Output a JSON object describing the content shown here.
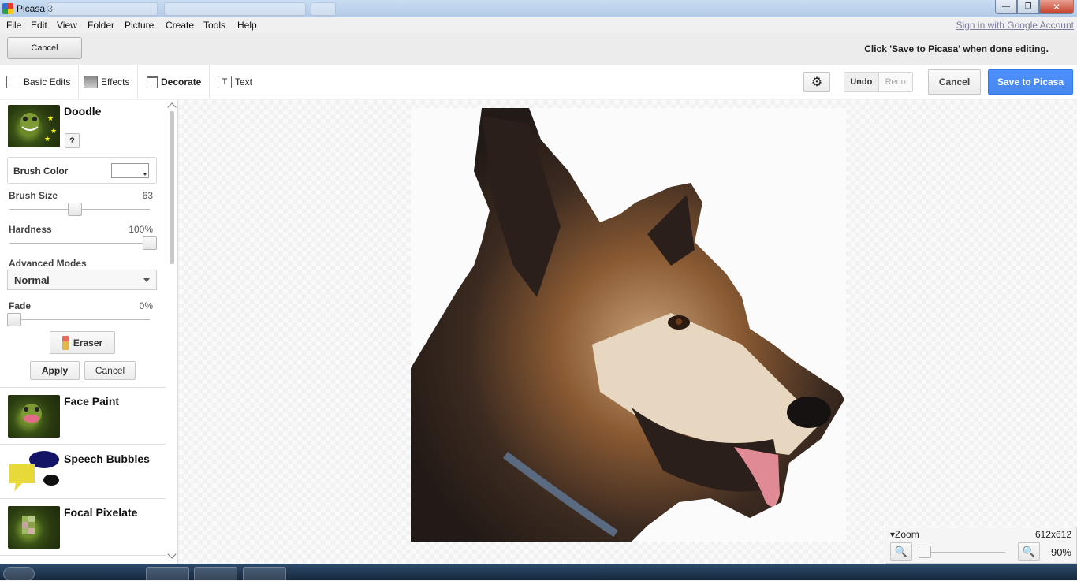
{
  "window": {
    "title": "Picasa 3",
    "minimize_glyph": "—",
    "restore_glyph": "❐",
    "close_glyph": "✕"
  },
  "menu": {
    "items": [
      "File",
      "Edit",
      "View",
      "Folder",
      "Picture",
      "Create",
      "Tools",
      "Help"
    ],
    "sign_in": "Sign in with Google Account"
  },
  "topbar": {
    "cancel_label": "Cancel",
    "hint": "Click 'Save to Picasa' when done editing."
  },
  "toolbar": {
    "tabs": [
      {
        "label": "Basic Edits",
        "icon": "basic-edits-icon"
      },
      {
        "label": "Effects",
        "icon": "effects-icon"
      },
      {
        "label": "Decorate",
        "icon": "paint-roller-icon"
      },
      {
        "label": "Text",
        "icon": "text-icon"
      }
    ],
    "active_tab": "Decorate",
    "settings_glyph": "⚙",
    "undo_label": "Undo",
    "redo_label": "Redo",
    "cancel_label": "Cancel",
    "save_label": "Save to Picasa",
    "save_color": "#4d90fe"
  },
  "doodle": {
    "title": "Doodle",
    "help_label": "?",
    "brush_color_label": "Brush Color",
    "brush_size_label": "Brush Size",
    "brush_size_value": "63",
    "brush_size_level": 0.45,
    "hardness_label": "Hardness",
    "hardness_value": "100%",
    "hardness_level": 1.0,
    "advanced_modes_label": "Advanced Modes",
    "mode_selected": "Normal",
    "fade_label": "Fade",
    "fade_value": "0%",
    "fade_level": 0.0,
    "eraser_label": "Eraser",
    "apply_label": "Apply",
    "cancel_label": "Cancel"
  },
  "effects_list": [
    {
      "title": "Face Paint"
    },
    {
      "title": "Speech Bubbles"
    },
    {
      "title": "Focal Pixelate"
    }
  ],
  "zoom": {
    "label": "Zoom",
    "dimensions": "612x612",
    "value": "90%",
    "level": 0.0,
    "zoom_out_glyph": "🔍",
    "zoom_in_glyph": "🔍"
  }
}
